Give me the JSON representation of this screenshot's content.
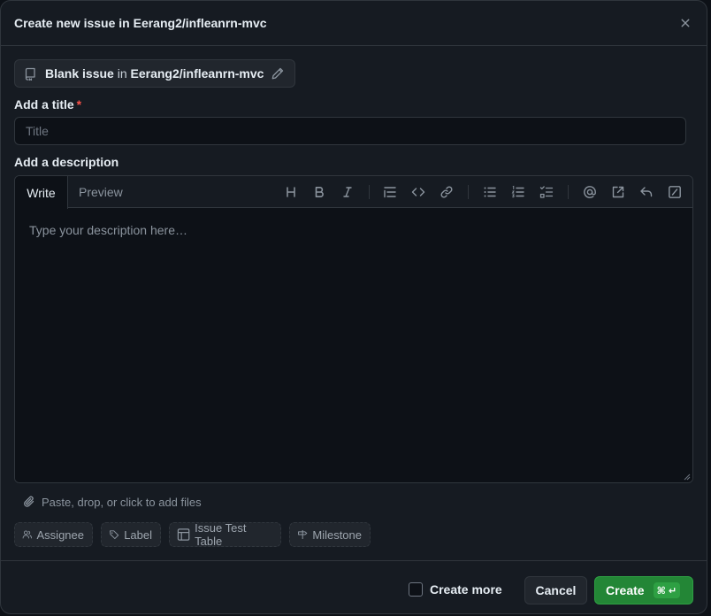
{
  "dialog": {
    "title": "Create new issue in Eerang2/infleanrn-mvc",
    "close_icon": "x-icon"
  },
  "template": {
    "name": "Blank issue",
    "connector": "in",
    "repo": "Eerang2/infleanrn-mvc",
    "repo_icon": "repo-icon",
    "edit_icon": "pencil-icon"
  },
  "title_field": {
    "label": "Add a title",
    "required_mark": "*",
    "value": "",
    "placeholder": "Title"
  },
  "description": {
    "label": "Add a description",
    "tabs": [
      {
        "label": "Write",
        "active": true
      },
      {
        "label": "Preview",
        "active": false
      }
    ],
    "toolbar": [
      "heading-icon",
      "bold-icon",
      "italic-icon",
      "quote-icon",
      "code-icon",
      "link-icon",
      "unordered-list-icon",
      "ordered-list-icon",
      "task-list-icon",
      "mention-icon",
      "reference-icon",
      "reply-icon",
      "slash-command-icon"
    ],
    "value": "",
    "placeholder": "Type your description here…"
  },
  "attach": {
    "text": "Paste, drop, or click to add files",
    "icon": "paperclip-icon"
  },
  "metadata": {
    "assignee": "Assignee",
    "label": "Label",
    "project": "Issue Test Table",
    "milestone": "Milestone"
  },
  "footer": {
    "create_more": "Create more",
    "create_more_checked": false,
    "cancel": "Cancel",
    "create": "Create",
    "shortcut_cmd": "⌘",
    "shortcut_enter": "↵"
  },
  "colors": {
    "background": "#161b22",
    "border": "#30363d",
    "primary": "#238636",
    "required": "#f85149"
  }
}
